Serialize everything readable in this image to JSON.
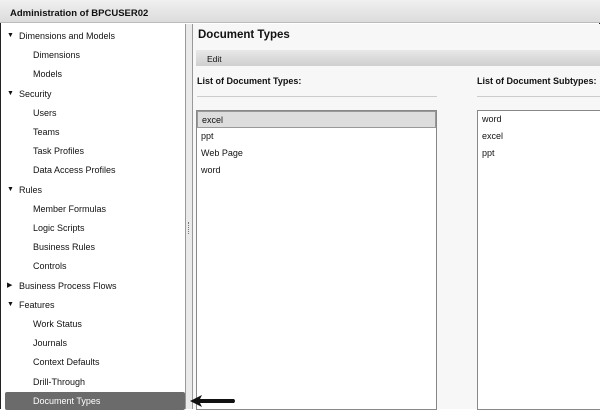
{
  "window": {
    "title": "Administration of BPCUSER02"
  },
  "sidebar": {
    "items": [
      {
        "label": "Dimensions and Models",
        "level": 0,
        "expanded": true
      },
      {
        "label": "Dimensions",
        "level": 1
      },
      {
        "label": "Models",
        "level": 1
      },
      {
        "label": "Security",
        "level": 0,
        "expanded": true
      },
      {
        "label": "Users",
        "level": 1
      },
      {
        "label": "Teams",
        "level": 1
      },
      {
        "label": "Task Profiles",
        "level": 1
      },
      {
        "label": "Data Access Profiles",
        "level": 1
      },
      {
        "label": "Rules",
        "level": 0,
        "expanded": true
      },
      {
        "label": "Member Formulas",
        "level": 1
      },
      {
        "label": "Logic Scripts",
        "level": 1
      },
      {
        "label": "Business Rules",
        "level": 1
      },
      {
        "label": "Controls",
        "level": 1
      },
      {
        "label": "Business Process Flows",
        "level": 0,
        "expanded": false
      },
      {
        "label": "Features",
        "level": 0,
        "expanded": true
      },
      {
        "label": "Work Status",
        "level": 1
      },
      {
        "label": "Journals",
        "level": 1
      },
      {
        "label": "Context Defaults",
        "level": 1
      },
      {
        "label": "Drill-Through",
        "level": 1
      },
      {
        "label": "Document Types",
        "level": 1,
        "selected": true
      }
    ]
  },
  "main": {
    "title": "Document Types",
    "toolbar": {
      "edit_label": "Edit"
    },
    "types": {
      "label": "List of Document Types:",
      "items": [
        "excel",
        "ppt",
        "Web Page",
        "word"
      ],
      "selected": "excel"
    },
    "subtypes": {
      "label": "List of Document Subtypes:",
      "items": [
        "word",
        "excel",
        "ppt"
      ]
    }
  },
  "colors": {
    "selected_bg": "#6b6b6b"
  }
}
